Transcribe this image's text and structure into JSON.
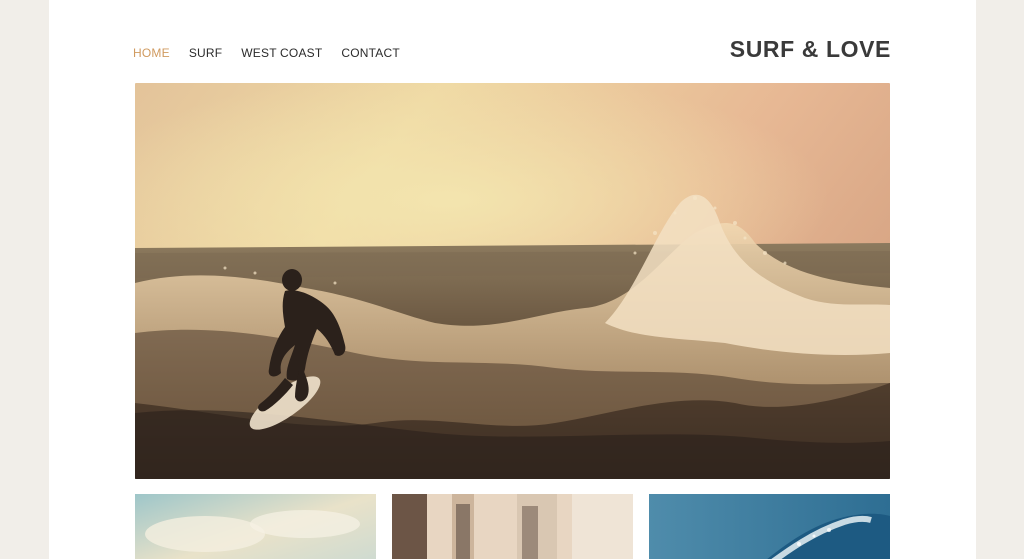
{
  "site": {
    "brand": "SURF & LOVE",
    "accent_color": "#d09a5f"
  },
  "nav": {
    "items": [
      {
        "label": "HOME",
        "active": true
      },
      {
        "label": "SURF",
        "active": false
      },
      {
        "label": "WEST COAST",
        "active": false
      },
      {
        "label": "CONTACT",
        "active": false
      }
    ]
  },
  "hero": {
    "image": "surfer-riding-wave-at-sunset"
  },
  "thumbnails": [
    {
      "image": "beach-sky-clouds"
    },
    {
      "image": "building-windows"
    },
    {
      "image": "blue-wave"
    }
  ]
}
